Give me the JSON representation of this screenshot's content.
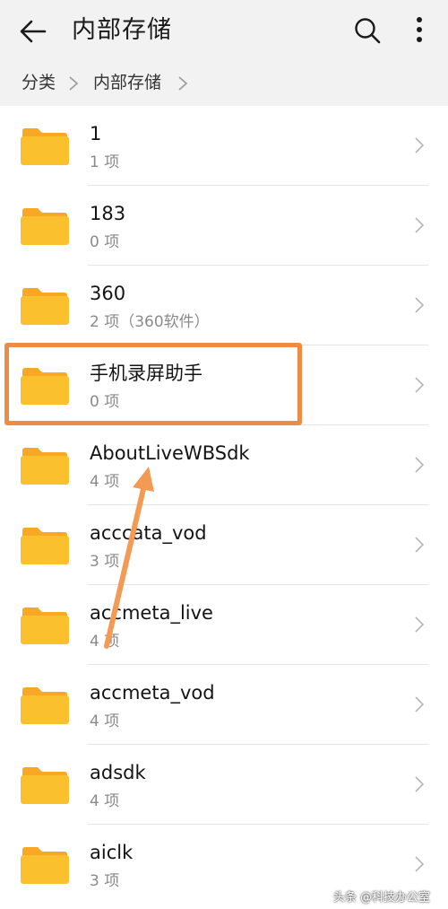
{
  "header": {
    "title": "内部存储",
    "icons": {
      "back": "arrow-left-icon",
      "search": "search-icon",
      "more": "more-vertical-icon"
    }
  },
  "breadcrumb": {
    "items": [
      "分类",
      "内部存储"
    ]
  },
  "folders": [
    {
      "name": "1",
      "meta": "1 项"
    },
    {
      "name": "183",
      "meta": "0 项"
    },
    {
      "name": "360",
      "meta": "2 项（360软件）"
    },
    {
      "name": "手机录屏助手",
      "meta": "0 项"
    },
    {
      "name": "AboutLiveWBSdk",
      "meta": "4 项"
    },
    {
      "name": "acccata_vod",
      "meta": "3 项"
    },
    {
      "name": "accmeta_live",
      "meta": "4 项"
    },
    {
      "name": "accmeta_vod",
      "meta": "4 项"
    },
    {
      "name": "adsdk",
      "meta": "4 项"
    },
    {
      "name": "aiclk",
      "meta": "3 项"
    }
  ],
  "annotation": {
    "highlight_color": "#ee8b45",
    "arrow_color": "#f39a55"
  },
  "colors": {
    "folder": "#fbc02d",
    "folder_tab": "#f9a825"
  },
  "watermark": "头条 @科技办公室"
}
